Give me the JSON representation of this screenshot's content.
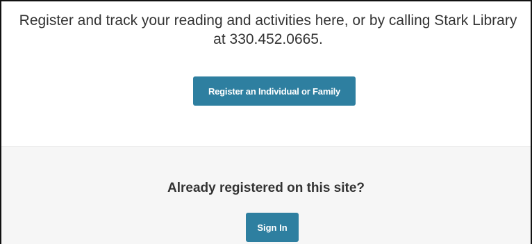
{
  "intro": {
    "text": "Register and track your reading and activities here, or by calling Stark Library at 330.452.0665."
  },
  "register": {
    "button_label": "Register an Individual or Family"
  },
  "signin": {
    "heading": "Already registered on this site?",
    "button_label": "Sign In"
  },
  "colors": {
    "button_bg": "#2e7fa0",
    "panel_bg": "#f6f6f6",
    "text": "#333333"
  }
}
